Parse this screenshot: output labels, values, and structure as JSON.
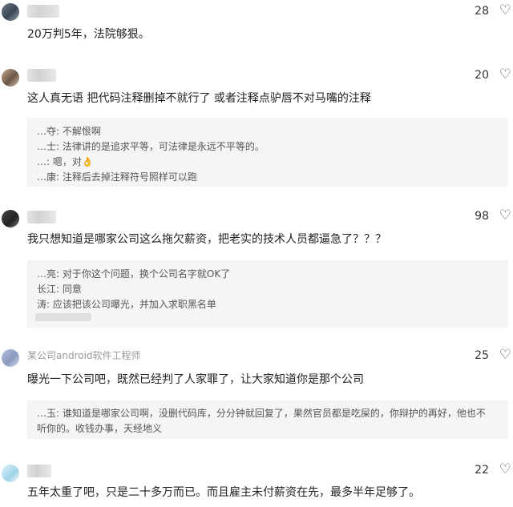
{
  "comments": [
    {
      "author": "",
      "likes": "28",
      "text": "20万判5年，法院够狠。",
      "replies": []
    },
    {
      "author": "",
      "likes": "20",
      "text": "这人真无语 把代码注释删掉不就行了 或者注释点驴唇不对马嘴的注释",
      "replies": [
        {
          "who": "…夺:",
          "text": "不解恨啊"
        },
        {
          "who": "…士:",
          "text": "法律讲的是追求平等，可法律是永远不平等的。"
        },
        {
          "who": "…:",
          "text": "嗯，对👌"
        },
        {
          "who": "…康:",
          "text": "注释后去掉注释符号照样可以跑"
        }
      ]
    },
    {
      "author": "",
      "likes": "98",
      "text": "我只想知道是哪家公司这么拖欠薪资，把老实的技术人员都逼急了？？？",
      "replies": [
        {
          "who": "…亮:",
          "text": "对于你这个问题，换个公司名字就OK了"
        },
        {
          "who": "长江:",
          "text": "同意"
        },
        {
          "who": "涛:",
          "text": "应该把该公司曝光，并加入求职黑名单"
        }
      ]
    },
    {
      "author": "某公司android软件工程师",
      "likes": "25",
      "text": "曝光一下公司吧，既然已经判了人家罪了，让大家知道你是那个公司",
      "replies": [
        {
          "who": "…玉:",
          "text": "谁知道是哪家公司啊，没删代码库，分分钟就回复了，果然官员都是吃屎的，你辩护的再好，他也不"
        },
        {
          "who": "",
          "text": "听你的。收钱办事，天经地义"
        }
      ]
    },
    {
      "author": "",
      "likes": "22",
      "text": "五年太重了吧，只是二十多万而已。而且雇主未付薪资在先，最多半年足够了。",
      "replies": []
    }
  ],
  "icons": {
    "like": "heart-outline-icon"
  }
}
